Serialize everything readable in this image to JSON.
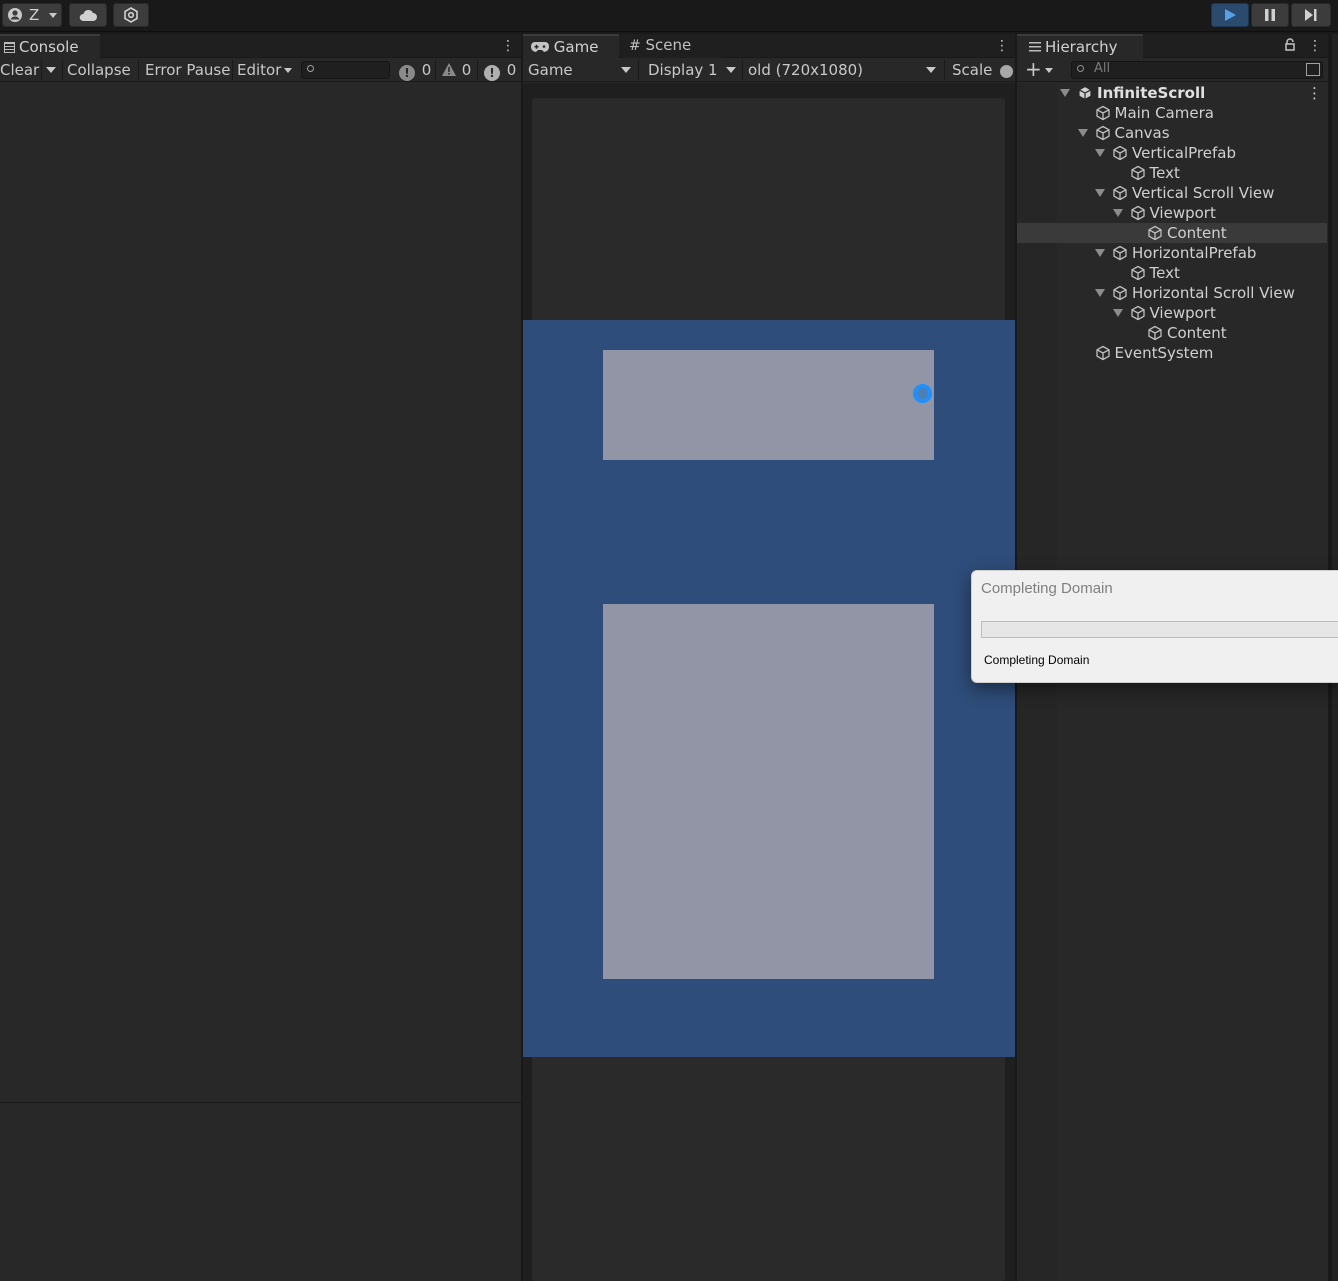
{
  "toolbar": {
    "account_label": "Z",
    "account_icon": "user-circle-icon",
    "cloud_icon": "cloud-icon",
    "services_icon": "hex-gear-icon",
    "play_icon": "play-icon",
    "pause_icon": "pause-icon",
    "step_icon": "step-icon",
    "play_active_color": "#2a4a6e"
  },
  "console": {
    "tab_label": "Console",
    "clear_label": "Clear",
    "collapse_label": "Collapse",
    "error_pause_label": "Error Pause",
    "editor_label": "Editor",
    "search_value": "",
    "info_count": "0",
    "warning_count": "0",
    "error_count": "0"
  },
  "game": {
    "tab_game_label": "Game",
    "tab_scene_label": "Scene",
    "mode_select": "Game",
    "display_select": "Display 1",
    "resolution_select": "old (720x1080)",
    "scale_label": "Scale",
    "canvas_color": "#2f4d7a",
    "panel_color": "#9195a5"
  },
  "hierarchy": {
    "tab_label": "Hierarchy",
    "search_placeholder": "All",
    "items": [
      {
        "label": "InfiniteScroll",
        "bold": true
      },
      {
        "label": "Main Camera"
      },
      {
        "label": "Canvas"
      },
      {
        "label": "VerticalPrefab"
      },
      {
        "label": "Text"
      },
      {
        "label": "Vertical Scroll View"
      },
      {
        "label": "Viewport"
      },
      {
        "label": "Content",
        "selected": true
      },
      {
        "label": "HorizontalPrefab"
      },
      {
        "label": "Text"
      },
      {
        "label": "Horizontal Scroll View"
      },
      {
        "label": "Viewport"
      },
      {
        "label": "Content"
      },
      {
        "label": "EventSystem"
      }
    ]
  },
  "dialog": {
    "title": "Completing Domain",
    "status": "Completing Domain",
    "progress": 0
  }
}
